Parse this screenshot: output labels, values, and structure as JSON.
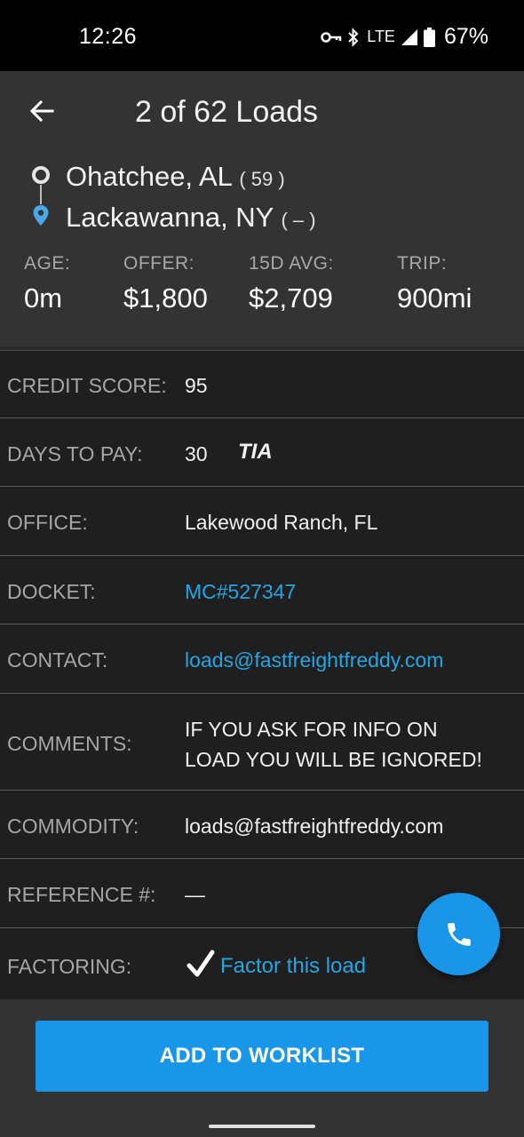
{
  "status_bar": {
    "time": "12:26",
    "network": "LTE",
    "battery": "67%"
  },
  "header": {
    "title": "2 of 62 Loads",
    "origin": {
      "city": "Ohatchee, AL",
      "extra": "( 59 )"
    },
    "destination": {
      "city": "Lackawanna, NY",
      "extra": "( – )"
    },
    "stats": [
      {
        "label": "AGE:",
        "value": "0m"
      },
      {
        "label": "OFFER:",
        "value": "$1,800"
      },
      {
        "label": "15D AVG:",
        "value": "$2,709"
      },
      {
        "label": "TRIP:",
        "value": "900mi"
      }
    ]
  },
  "details": {
    "credit_score": {
      "label": "CREDIT SCORE:",
      "value": "95"
    },
    "days_to_pay": {
      "label": "DAYS TO PAY:",
      "value": "30",
      "badge": "TIA"
    },
    "office": {
      "label": "OFFICE:",
      "value": "Lakewood Ranch, FL"
    },
    "docket": {
      "label": "DOCKET:",
      "value": "MC#527347"
    },
    "contact": {
      "label": "CONTACT:",
      "value": "loads@fastfreightfreddy.com"
    },
    "comments": {
      "label": "COMMENTS:",
      "line1": "IF YOU ASK FOR INFO ON",
      "line2": "LOAD YOU WILL BE IGNORED!"
    },
    "commodity": {
      "label": "COMMODITY:",
      "value": "loads@fastfreightfreddy.com"
    },
    "reference": {
      "label": "REFERENCE #:",
      "value": "—"
    },
    "factoring": {
      "label": "FACTORING:",
      "value": "Factor this load"
    }
  },
  "actions": {
    "add_to_worklist": "ADD TO WORKLIST"
  },
  "colors": {
    "accent": "#1a96e8",
    "link": "#26a5e4",
    "header_bg": "#333333",
    "body_bg": "#1f1f1f"
  }
}
